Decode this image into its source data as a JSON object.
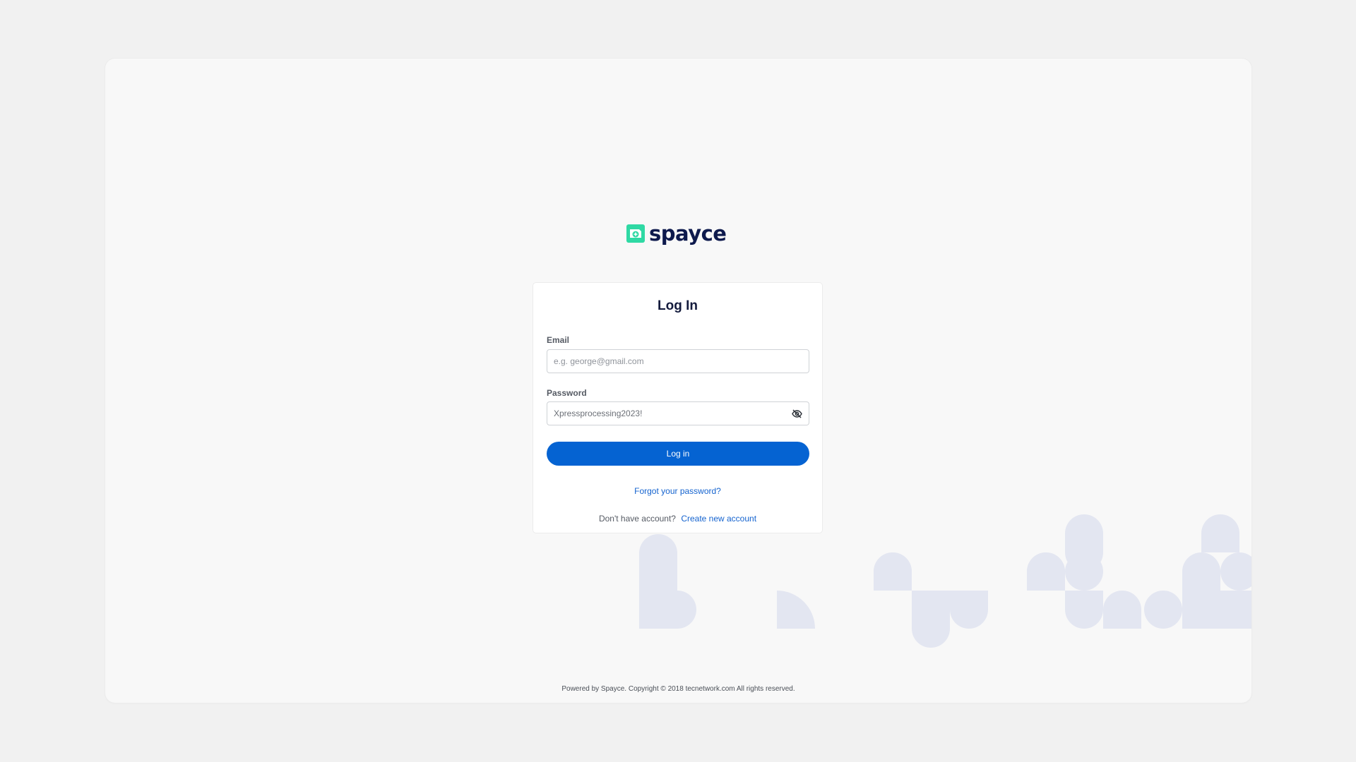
{
  "brand": {
    "name": "spayce",
    "accent_color": "#2fd9a4",
    "text_color": "#0e1a4d",
    "icon": "spayce-logo-icon"
  },
  "login_form": {
    "title": "Log In",
    "email": {
      "label": "Email",
      "placeholder": "e.g. george@gmail.com",
      "value": ""
    },
    "password": {
      "label": "Password",
      "value": "Xpressprocessing2023!",
      "toggle_icon": "eye-off-icon"
    },
    "submit_label": "Log in",
    "forgot_link": "Forgot your password?",
    "signup_prompt": "Don't have account?",
    "signup_link": "Create new account"
  },
  "footer": {
    "text": "Powered by Spayce. Copyright © 2018 tecnetwork.com All rights reserved."
  },
  "colors": {
    "primary": "#0563d2",
    "link": "#1463cf",
    "page_background": "#f1f1f1",
    "decoration": "#e3e6f1"
  }
}
